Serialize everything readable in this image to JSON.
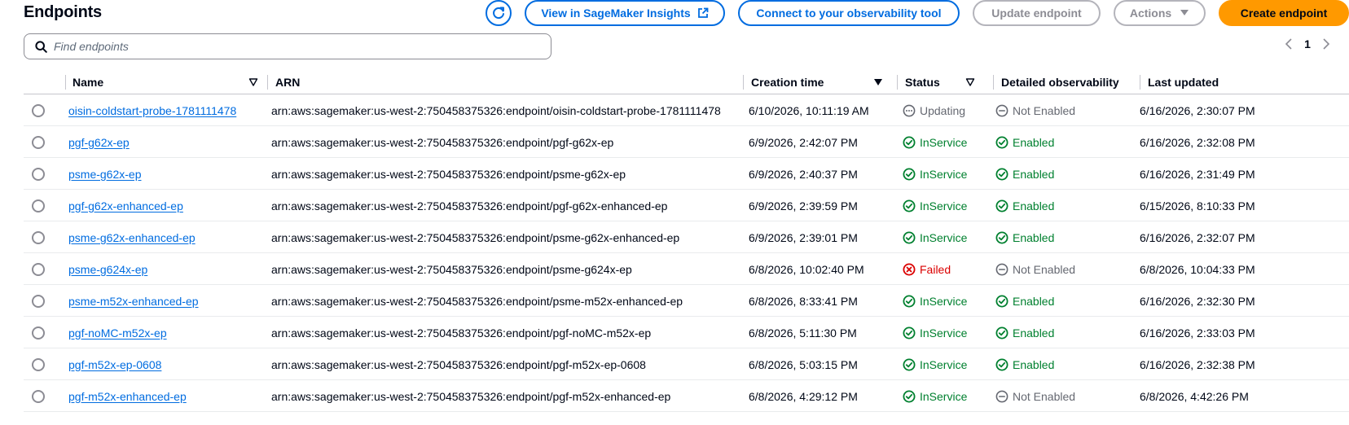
{
  "header": {
    "title": "Endpoints",
    "view_insights_label": "View in SageMaker Insights",
    "connect_label": "Connect to your observability tool",
    "update_label": "Update endpoint",
    "actions_label": "Actions",
    "create_label": "Create endpoint"
  },
  "search": {
    "placeholder": "Find endpoints",
    "value": ""
  },
  "pagination": {
    "current_page": "1"
  },
  "columns": {
    "name": "Name",
    "arn": "ARN",
    "creation_time": "Creation time",
    "status": "Status",
    "detailed_observability": "Detailed observability",
    "last_updated": "Last updated"
  },
  "colors": {
    "link": "#006ce0",
    "success": "#00802f",
    "error": "#db0000",
    "muted": "#656871",
    "primary_button": "#ff9900"
  },
  "rows": [
    {
      "name": "oisin-coldstart-probe-1781111478",
      "arn": "arn:aws:sagemaker:us-west-2:750458375326:endpoint/oisin-coldstart-probe-1781111478",
      "creation_time": "6/10/2026, 10:11:19 AM",
      "status": "Updating",
      "status_type": "pending",
      "observability": "Not Enabled",
      "observability_type": "disabled",
      "last_updated": "6/16/2026, 2:30:07 PM"
    },
    {
      "name": "pgf-g62x-ep",
      "arn": "arn:aws:sagemaker:us-west-2:750458375326:endpoint/pgf-g62x-ep",
      "creation_time": "6/9/2026, 2:42:07 PM",
      "status": "InService",
      "status_type": "success",
      "observability": "Enabled",
      "observability_type": "success",
      "last_updated": "6/16/2026, 2:32:08 PM"
    },
    {
      "name": "psme-g62x-ep",
      "arn": "arn:aws:sagemaker:us-west-2:750458375326:endpoint/psme-g62x-ep",
      "creation_time": "6/9/2026, 2:40:37 PM",
      "status": "InService",
      "status_type": "success",
      "observability": "Enabled",
      "observability_type": "success",
      "last_updated": "6/16/2026, 2:31:49 PM"
    },
    {
      "name": "pgf-g62x-enhanced-ep",
      "arn": "arn:aws:sagemaker:us-west-2:750458375326:endpoint/pgf-g62x-enhanced-ep",
      "creation_time": "6/9/2026, 2:39:59 PM",
      "status": "InService",
      "status_type": "success",
      "observability": "Enabled",
      "observability_type": "success",
      "last_updated": "6/15/2026, 8:10:33 PM"
    },
    {
      "name": "psme-g62x-enhanced-ep",
      "arn": "arn:aws:sagemaker:us-west-2:750458375326:endpoint/psme-g62x-enhanced-ep",
      "creation_time": "6/9/2026, 2:39:01 PM",
      "status": "InService",
      "status_type": "success",
      "observability": "Enabled",
      "observability_type": "success",
      "last_updated": "6/16/2026, 2:32:07 PM"
    },
    {
      "name": "psme-g624x-ep",
      "arn": "arn:aws:sagemaker:us-west-2:750458375326:endpoint/psme-g624x-ep",
      "creation_time": "6/8/2026, 10:02:40 PM",
      "status": "Failed",
      "status_type": "error",
      "observability": "Not Enabled",
      "observability_type": "disabled",
      "last_updated": "6/8/2026, 10:04:33 PM"
    },
    {
      "name": "psme-m52x-enhanced-ep",
      "arn": "arn:aws:sagemaker:us-west-2:750458375326:endpoint/psme-m52x-enhanced-ep",
      "creation_time": "6/8/2026, 8:33:41 PM",
      "status": "InService",
      "status_type": "success",
      "observability": "Enabled",
      "observability_type": "success",
      "last_updated": "6/16/2026, 2:32:30 PM"
    },
    {
      "name": "pgf-noMC-m52x-ep",
      "arn": "arn:aws:sagemaker:us-west-2:750458375326:endpoint/pgf-noMC-m52x-ep",
      "creation_time": "6/8/2026, 5:11:30 PM",
      "status": "InService",
      "status_type": "success",
      "observability": "Enabled",
      "observability_type": "success",
      "last_updated": "6/16/2026, 2:33:03 PM"
    },
    {
      "name": "pgf-m52x-ep-0608",
      "arn": "arn:aws:sagemaker:us-west-2:750458375326:endpoint/pgf-m52x-ep-0608",
      "creation_time": "6/8/2026, 5:03:15 PM",
      "status": "InService",
      "status_type": "success",
      "observability": "Enabled",
      "observability_type": "success",
      "last_updated": "6/16/2026, 2:32:38 PM"
    },
    {
      "name": "pgf-m52x-enhanced-ep",
      "arn": "arn:aws:sagemaker:us-west-2:750458375326:endpoint/pgf-m52x-enhanced-ep",
      "creation_time": "6/8/2026, 4:29:12 PM",
      "status": "InService",
      "status_type": "success",
      "observability": "Not Enabled",
      "observability_type": "disabled",
      "last_updated": "6/8/2026, 4:42:26 PM"
    }
  ]
}
